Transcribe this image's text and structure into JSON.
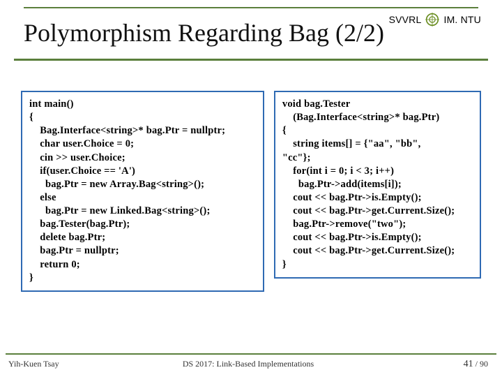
{
  "brand": {
    "left": "SVVRL",
    "at": "@",
    "right": "IM. NTU"
  },
  "title": "Polymorphism Regarding Bag (2/2)",
  "code_left": "int main()\n{\n    Bag.Interface<string>* bag.Ptr = nullptr;\n    char user.Choice = 0;\n    cin >> user.Choice;\n    if(user.Choice == 'A')\n      bag.Ptr = new Array.Bag<string>();\n    else\n      bag.Ptr = new Linked.Bag<string>();\n    bag.Tester(bag.Ptr);\n    delete bag.Ptr;\n    bag.Ptr = nullptr;\n    return 0;\n}",
  "code_right": "void bag.Tester\n    (Bag.Interface<string>* bag.Ptr)\n{\n    string items[] = {\"aa\", \"bb\",\n\"cc\"};\n    for(int i = 0; i < 3; i++)\n      bag.Ptr->add(items[i]);\n    cout << bag.Ptr->is.Empty();\n    cout << bag.Ptr->get.Current.Size();\n    bag.Ptr->remove(\"two\");\n    cout << bag.Ptr->is.Empty();\n    cout << bag.Ptr->get.Current.Size();\n}",
  "footer": {
    "author": "Yih-Kuen Tsay",
    "course": "DS 2017: Link-Based Implementations",
    "page_current": "41",
    "page_sep": " / ",
    "page_total": "90"
  }
}
